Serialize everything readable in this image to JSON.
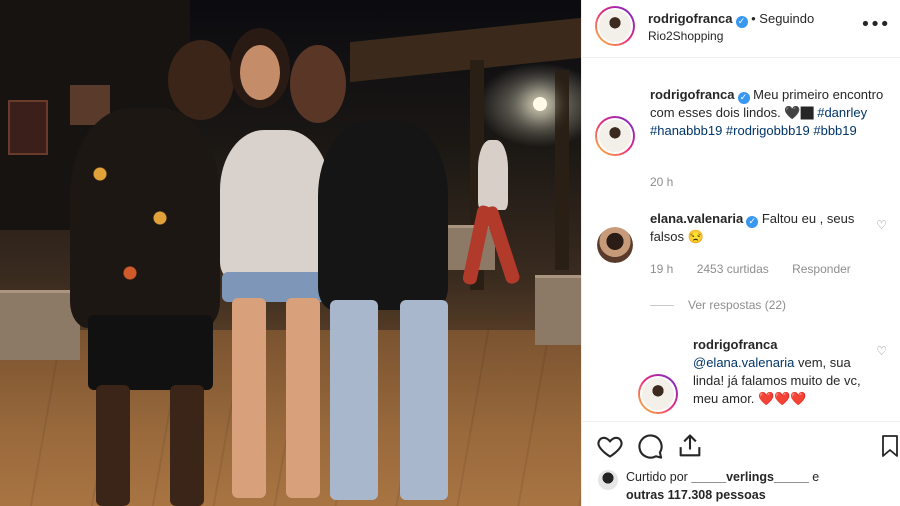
{
  "post": {
    "author": "rodrigofranca",
    "follow_status": "• Seguindo",
    "location": "Rio2Shopping",
    "more_icon": "ellipsis-icon"
  },
  "caption": {
    "author": "rodrigofranca",
    "text": "Meu primeiro encontro com esses dois lindos.",
    "emoji": "🖤🏿",
    "hashtags": "#danrley #hanabbb19 #rodrigobbb19 #bbb19",
    "time": "20 h"
  },
  "comments": [
    {
      "author": "elana.valenaria",
      "text": "Faltou eu , seus falsos 😒",
      "time": "19 h",
      "likes": "2453 curtidas",
      "reply": "Responder",
      "view_replies": "Ver respostas (22)"
    },
    {
      "author": "rodrigofranca",
      "mention": "@elana.valenaria",
      "text": " vem, sua linda! já falamos muito de vc, meu amor. ❤️❤️❤️"
    }
  ],
  "likes": {
    "prefix": "Curtido por ",
    "user": "_____verlings_____",
    "middle": " e ",
    "others": "outras 117.308 pessoas"
  },
  "colors": {
    "verified": "#3897f0",
    "link": "#003569",
    "muted": "#8e8e8e"
  }
}
